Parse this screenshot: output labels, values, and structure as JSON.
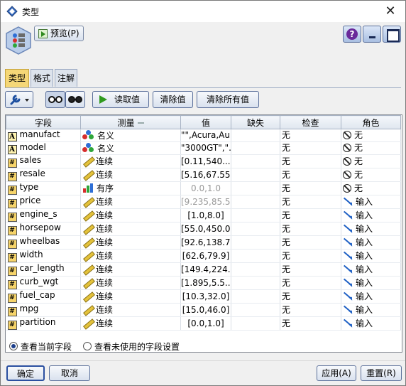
{
  "window": {
    "title": "类型",
    "close_glyph": "✕"
  },
  "toolbar_top": {
    "preview_label": "预览(P)"
  },
  "tabs": [
    {
      "label": "类型",
      "active": true
    },
    {
      "label": "格式",
      "active": false
    },
    {
      "label": "注解",
      "active": false
    }
  ],
  "toolbar": {
    "read_values": "读取值",
    "clear_values": "清除值",
    "clear_all_values": "清除所有值"
  },
  "table": {
    "headers": {
      "field": "字段",
      "measure": "测量",
      "value": "值",
      "missing": "缺失",
      "check": "检查",
      "role": "角色"
    },
    "rows": [
      {
        "type_icon": "A",
        "field": "manufact",
        "measure": "名义",
        "measure_icon": "nominal",
        "value": "\"\",Acura,Au...",
        "value_gray": false,
        "missing": "",
        "check": "无",
        "role": "无",
        "role_icon": "none"
      },
      {
        "type_icon": "A",
        "field": "model",
        "measure": "名义",
        "measure_icon": "nominal",
        "value": "\"3000GT\",\"...",
        "value_gray": false,
        "missing": "",
        "check": "无",
        "role": "无",
        "role_icon": "none"
      },
      {
        "type_icon": "num",
        "field": "sales",
        "measure": "连续",
        "measure_icon": "continuous",
        "value": "[0.11,540....",
        "value_gray": false,
        "missing": "",
        "check": "无",
        "role": "无",
        "role_icon": "none"
      },
      {
        "type_icon": "num",
        "field": "resale",
        "measure": "连续",
        "measure_icon": "continuous",
        "value": "[5.16,67.55]",
        "value_gray": false,
        "missing": "",
        "check": "无",
        "role": "无",
        "role_icon": "none"
      },
      {
        "type_icon": "num",
        "field": "type",
        "measure": "有序",
        "measure_icon": "ordinal",
        "value": "0.0,1.0",
        "value_gray": true,
        "missing": "",
        "check": "无",
        "role": "无",
        "role_icon": "none"
      },
      {
        "type_icon": "num",
        "field": "price",
        "measure": "连续",
        "measure_icon": "continuous",
        "value": "[9.235,85.5]",
        "value_gray": true,
        "missing": "",
        "check": "无",
        "role": "输入",
        "role_icon": "input"
      },
      {
        "type_icon": "num",
        "field": "engine_s",
        "measure": "连续",
        "measure_icon": "continuous",
        "value": "[1.0,8.0]",
        "value_gray": false,
        "missing": "",
        "check": "无",
        "role": "输入",
        "role_icon": "input"
      },
      {
        "type_icon": "num",
        "field": "horsepow",
        "measure": "连续",
        "measure_icon": "continuous",
        "value": "[55.0,450.0]",
        "value_gray": false,
        "missing": "",
        "check": "无",
        "role": "输入",
        "role_icon": "input"
      },
      {
        "type_icon": "num",
        "field": "wheelbas",
        "measure": "连续",
        "measure_icon": "continuous",
        "value": "[92.6,138.7]",
        "value_gray": false,
        "missing": "",
        "check": "无",
        "role": "输入",
        "role_icon": "input"
      },
      {
        "type_icon": "num",
        "field": "width",
        "measure": "连续",
        "measure_icon": "continuous",
        "value": "[62.6,79.9]",
        "value_gray": false,
        "missing": "",
        "check": "无",
        "role": "输入",
        "role_icon": "input"
      },
      {
        "type_icon": "num",
        "field": "car_length",
        "measure": "连续",
        "measure_icon": "continuous",
        "value": "[149.4,224....",
        "value_gray": false,
        "missing": "",
        "check": "无",
        "role": "输入",
        "role_icon": "input"
      },
      {
        "type_icon": "num",
        "field": "curb_wgt",
        "measure": "连续",
        "measure_icon": "continuous",
        "value": "[1.895,5.5...",
        "value_gray": false,
        "missing": "",
        "check": "无",
        "role": "输入",
        "role_icon": "input"
      },
      {
        "type_icon": "num",
        "field": "fuel_cap",
        "measure": "连续",
        "measure_icon": "continuous",
        "value": "[10.3,32.0]",
        "value_gray": false,
        "missing": "",
        "check": "无",
        "role": "输入",
        "role_icon": "input"
      },
      {
        "type_icon": "num",
        "field": "mpg",
        "measure": "连续",
        "measure_icon": "continuous",
        "value": "[15.0,46.0]",
        "value_gray": false,
        "missing": "",
        "check": "无",
        "role": "输入",
        "role_icon": "input"
      },
      {
        "type_icon": "num",
        "field": "partition",
        "measure": "连续",
        "measure_icon": "continuous",
        "value": "[0.0,1.0]",
        "value_gray": false,
        "missing": "",
        "check": "无",
        "role": "输入",
        "role_icon": "input"
      }
    ]
  },
  "view_options": {
    "current_fields": "查看当前字段",
    "unused_fields": "查看未使用的字段设置",
    "selected": "current_fields"
  },
  "buttons": {
    "ok": "确定",
    "cancel": "取消",
    "apply": "应用(A)",
    "reset": "重置(R)"
  },
  "colors": {
    "active_tab": "#f5d777",
    "role_input": "#1d5fc4",
    "header_bg": "#dfe6ef"
  }
}
